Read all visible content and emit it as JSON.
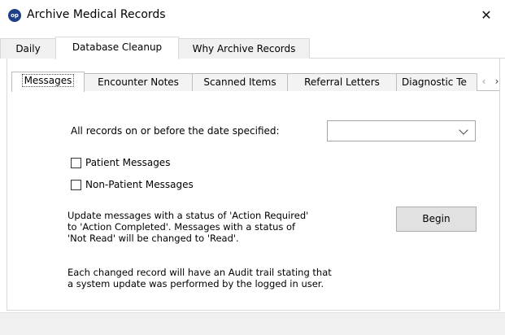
{
  "window": {
    "title": "Archive Medical Records",
    "icon_text": "op",
    "icon_color": "#1f3f86",
    "close_glyph": "✕"
  },
  "outer_tabs": [
    {
      "label": "Daily",
      "active": false
    },
    {
      "label": "Database Cleanup",
      "active": true
    },
    {
      "label": "Why Archive Records",
      "active": false
    }
  ],
  "inner_tabs": [
    {
      "label": "Messages",
      "active": true
    },
    {
      "label": "Encounter Notes",
      "active": false
    },
    {
      "label": "Scanned Items",
      "active": false
    },
    {
      "label": "Referral Letters",
      "active": false
    },
    {
      "label": "Diagnostic Te",
      "active": false
    }
  ],
  "tab_scroll": {
    "left_glyph": "‹",
    "right_glyph": "›"
  },
  "messages_tab": {
    "date_label": "All records on or before the date specified:",
    "date_value": "",
    "checkboxes": [
      {
        "label": "Patient Messages",
        "checked": false
      },
      {
        "label": "Non-Patient Messages",
        "checked": false
      }
    ],
    "update_text": [
      "Update messages with a status of 'Action Required'",
      "to 'Action Completed'. Messages with a status of",
      "'Not Read' will be changed to 'Read'."
    ],
    "audit_text": [
      "Each changed record will have an Audit trail stating that",
      "a system update was performed by the logged in user."
    ],
    "begin_label": "Begin"
  }
}
